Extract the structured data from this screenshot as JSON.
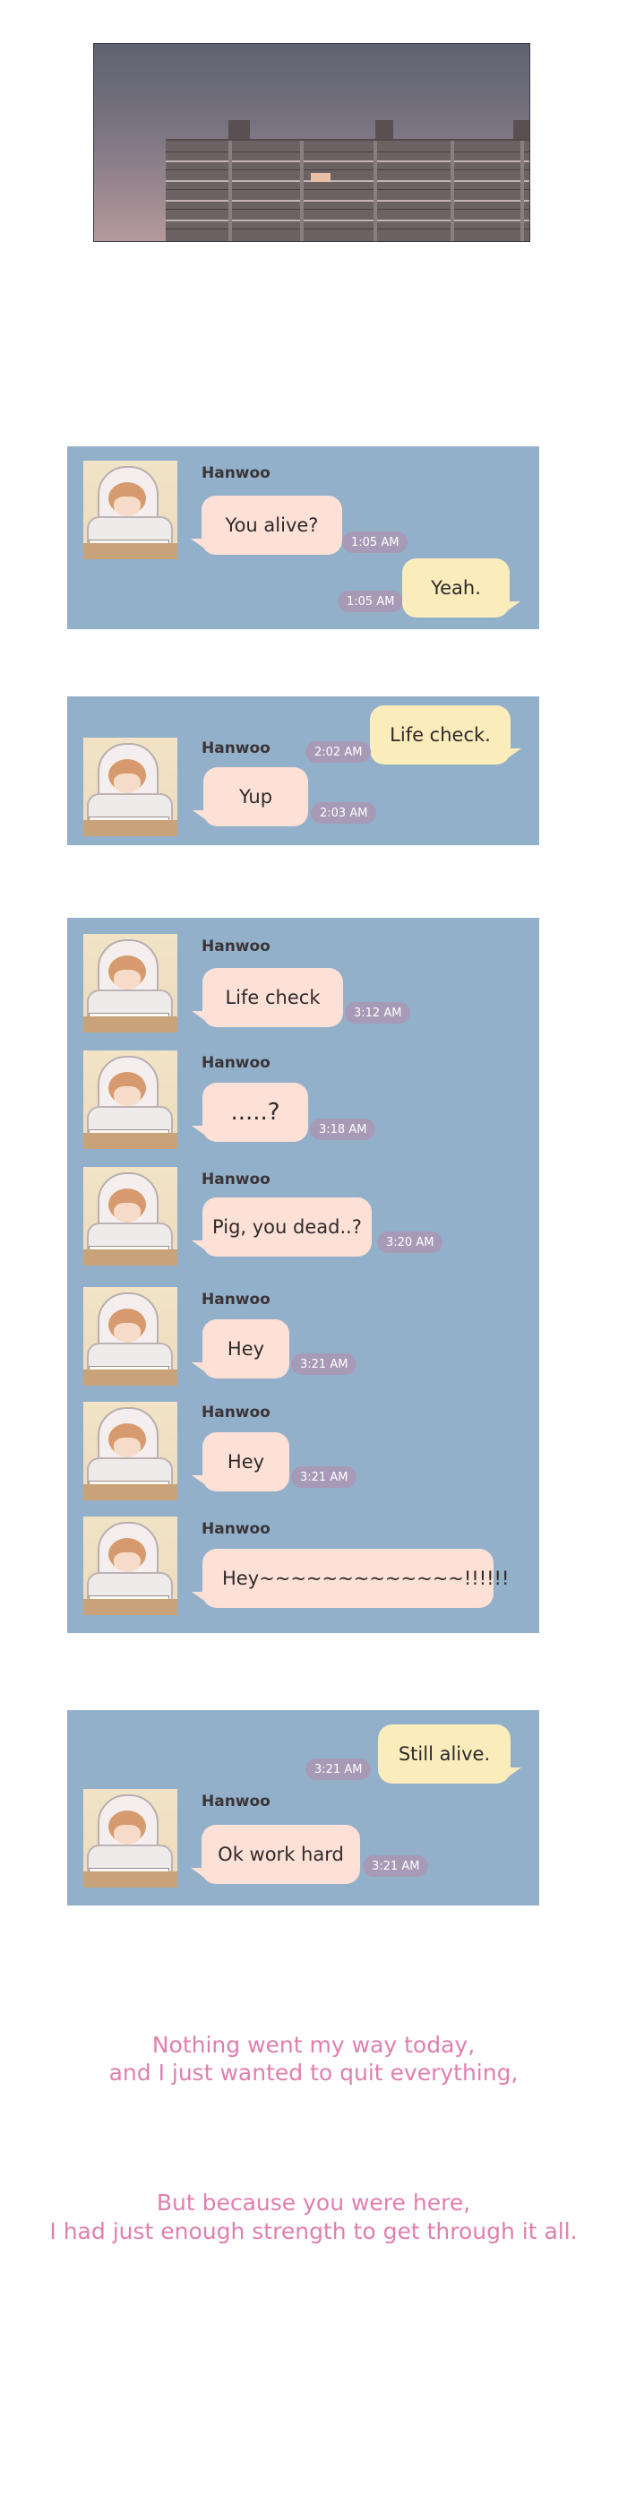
{
  "name": "Hanwoo",
  "chat1": {
    "msg1": "You alive?",
    "time1": "1:05 AM",
    "reply1": "Yeah.",
    "time2": "1:05 AM"
  },
  "chat2": {
    "reply1": "Life check.",
    "time1": "2:02 AM",
    "msg1": "Yup",
    "time2": "2:03 AM"
  },
  "chat3": {
    "messages": [
      {
        "text": "Life check",
        "time": "3:12 AM"
      },
      {
        "text": ".....?",
        "time": "3:18 AM"
      },
      {
        "text": "Pig, you dead..?",
        "time": "3:20 AM"
      },
      {
        "text": "Hey",
        "time": "3:21 AM"
      },
      {
        "text": "Hey",
        "time": "3:21 AM"
      },
      {
        "text": "Hey~~~~~~~~~~~~~!!!!!!"
      }
    ]
  },
  "chat4": {
    "reply1": "Still alive.",
    "time1": "3:21 AM",
    "msg1": "Ok work hard",
    "time2": "3:21 AM"
  },
  "captions": {
    "line1": "Nothing went my way today,",
    "line2": "and I just wanted to quit everything,",
    "line3": "But because you were here,",
    "line4": "I had just enough strength to get through it all."
  }
}
